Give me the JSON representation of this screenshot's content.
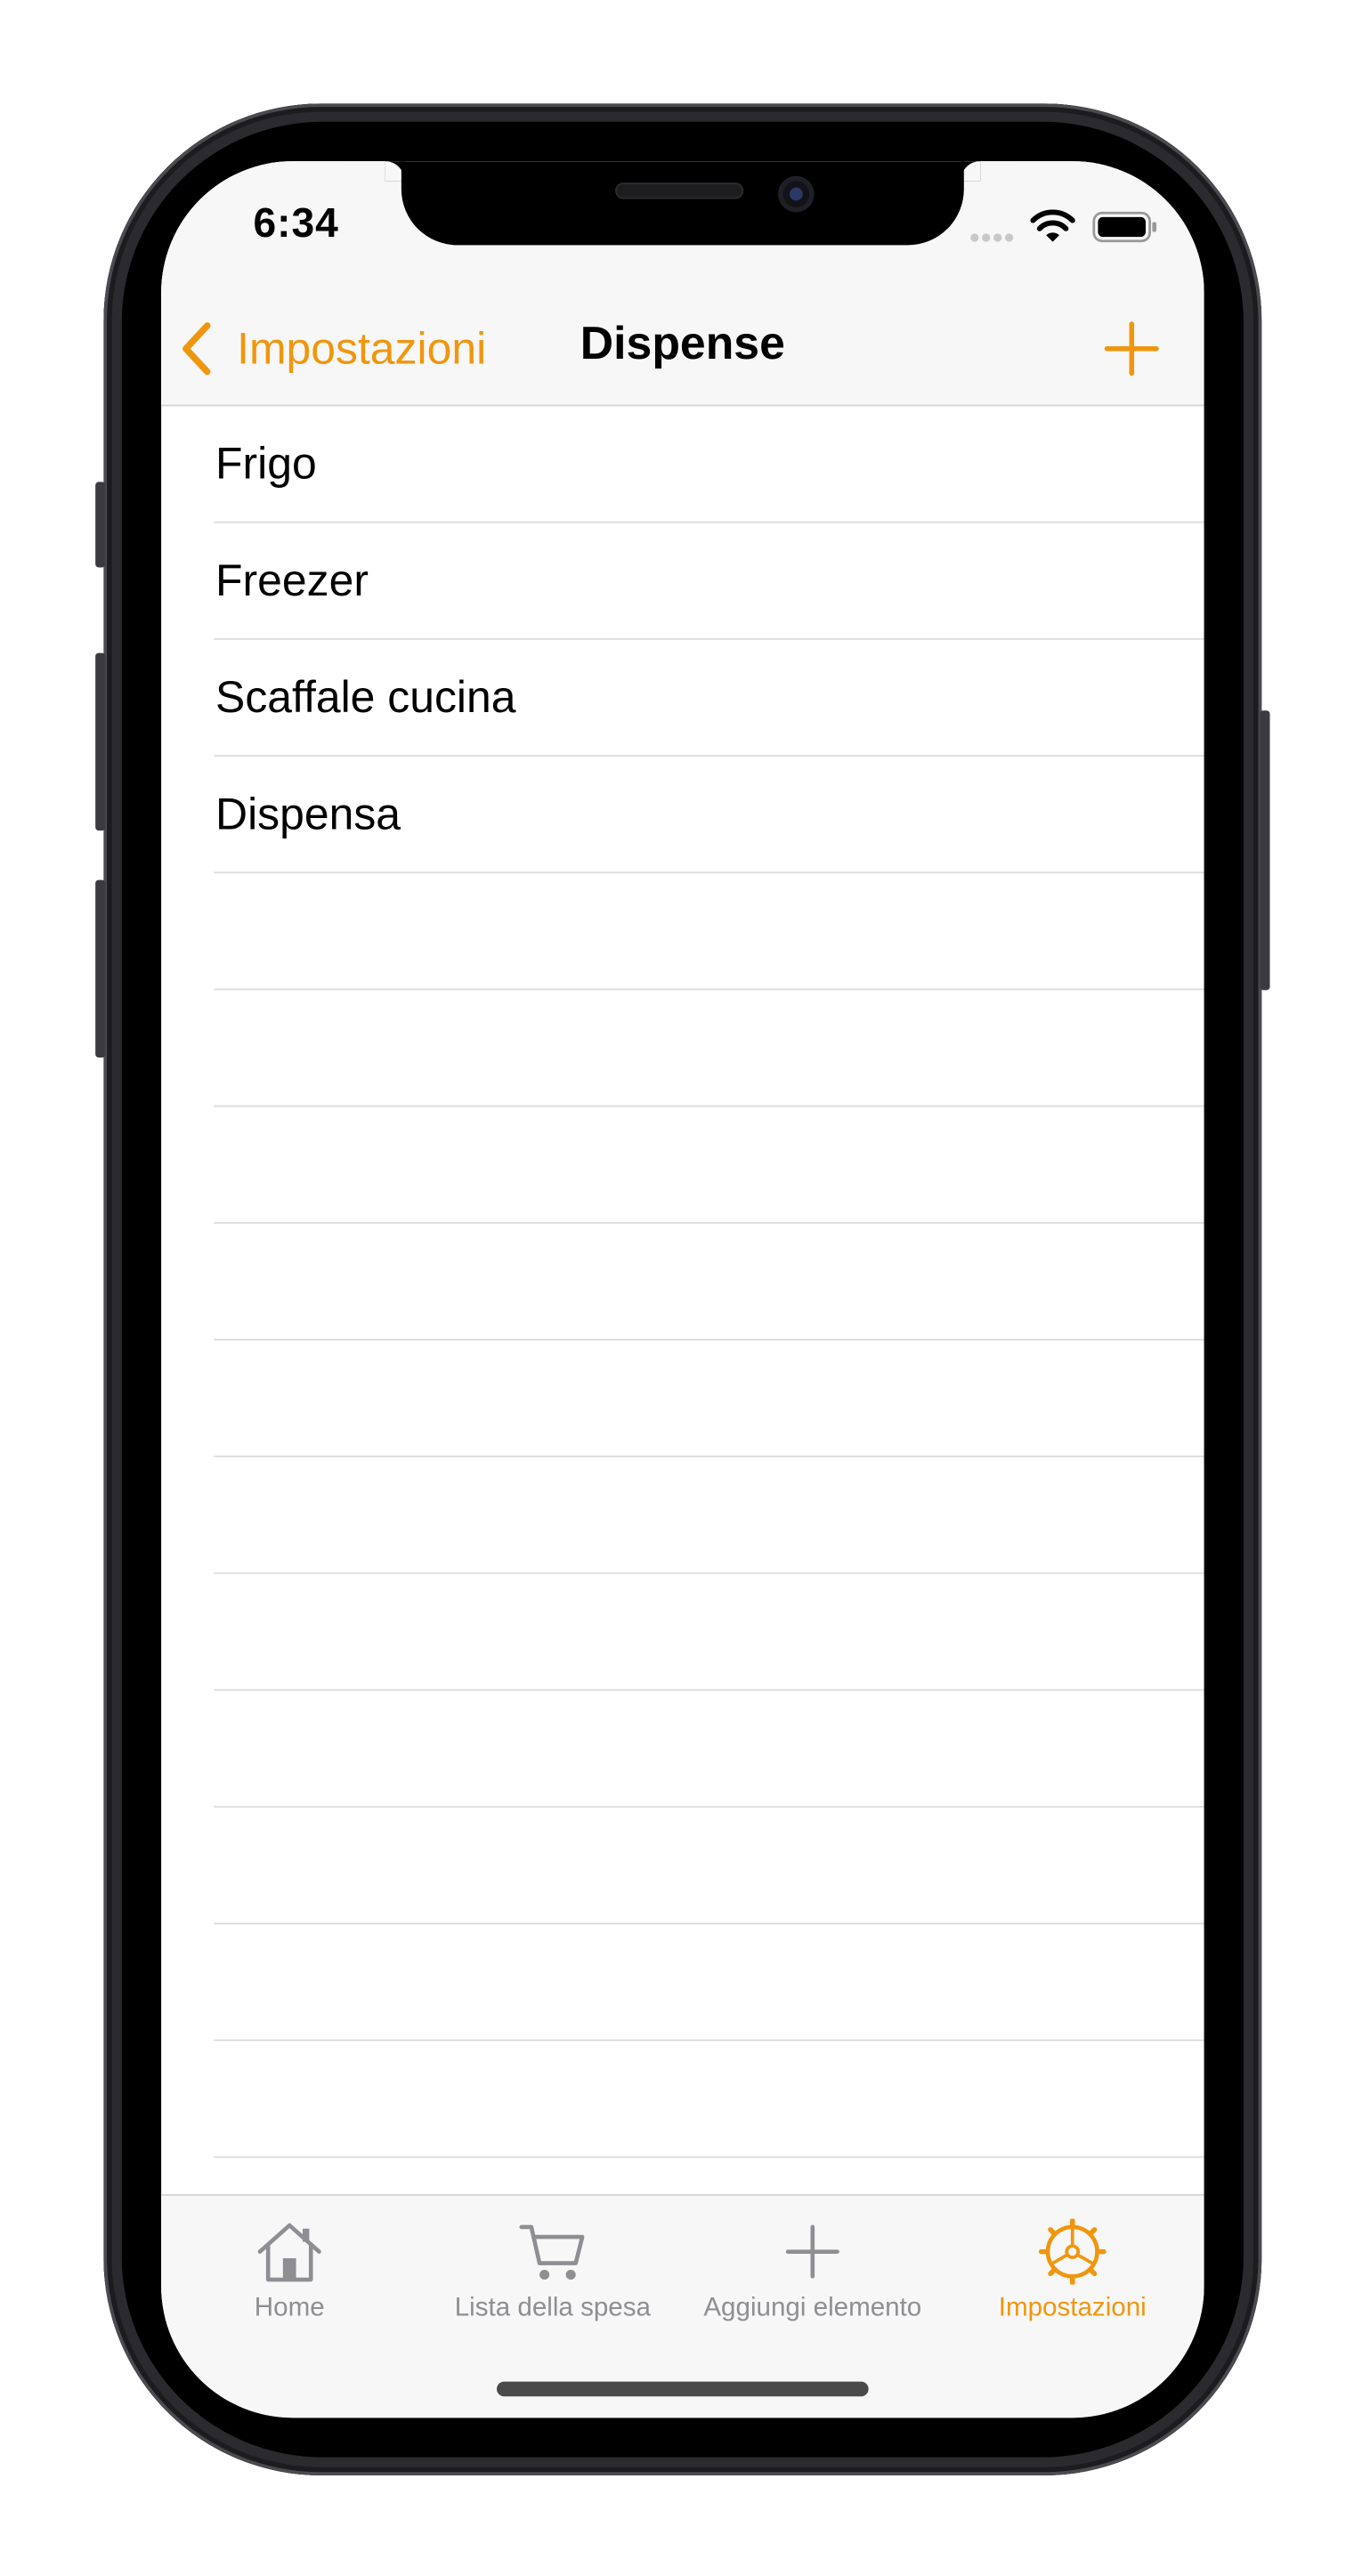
{
  "status_bar": {
    "time": "6:34"
  },
  "nav": {
    "back_label": "Impostazioni",
    "title": "Dispense",
    "add_icon": "plus-icon"
  },
  "list": {
    "items": [
      "Frigo",
      "Freezer",
      "Scaffale cucina",
      "Dispensa"
    ],
    "empty_rows": 11
  },
  "tab_bar": {
    "tabs": [
      {
        "label": "Home",
        "icon": "house-icon",
        "active": false
      },
      {
        "label": "Lista della spesa",
        "icon": "cart-icon",
        "active": false
      },
      {
        "label": "Aggiungi elemento",
        "icon": "plus-icon",
        "active": false
      },
      {
        "label": "Impostazioni",
        "icon": "gear-icon",
        "active": true
      }
    ]
  },
  "colors": {
    "accent": "#f0960e",
    "inactive_tab": "#8e8e93",
    "bar_background": "#f7f7f7",
    "separator": "#dcdcdc"
  }
}
